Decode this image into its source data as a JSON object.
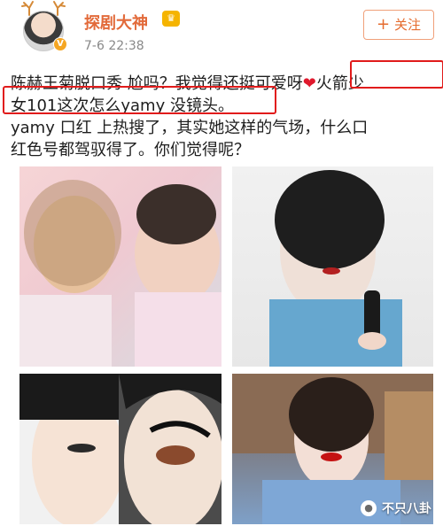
{
  "header": {
    "username": "探剧大神",
    "vip_badge": "♛",
    "verified_badge": "V",
    "timestamp": "7-6 22:38",
    "follow_button": {
      "plus": "+",
      "label": "关注"
    }
  },
  "post": {
    "line1_before": "陈赫王菊脱口秀 尬吗？我觉得还挺可爱呀",
    "line1_heart": "❤",
    "line1_after": "火箭少",
    "line2": "女101这次怎么yamy 没镜头。",
    "line3": "yamy 口红 上热搜了，其实她这样的气场，什么口",
    "line4": "红色号都驾驭得了。你们觉得呢？"
  },
  "watermark": {
    "label": "不只八卦",
    "icon": "wechat-icon"
  },
  "colors": {
    "username": "#e26a3a",
    "follow_border": "#f0a07a",
    "highlight_box": "#e11b1b",
    "heart": "#e0192d"
  }
}
